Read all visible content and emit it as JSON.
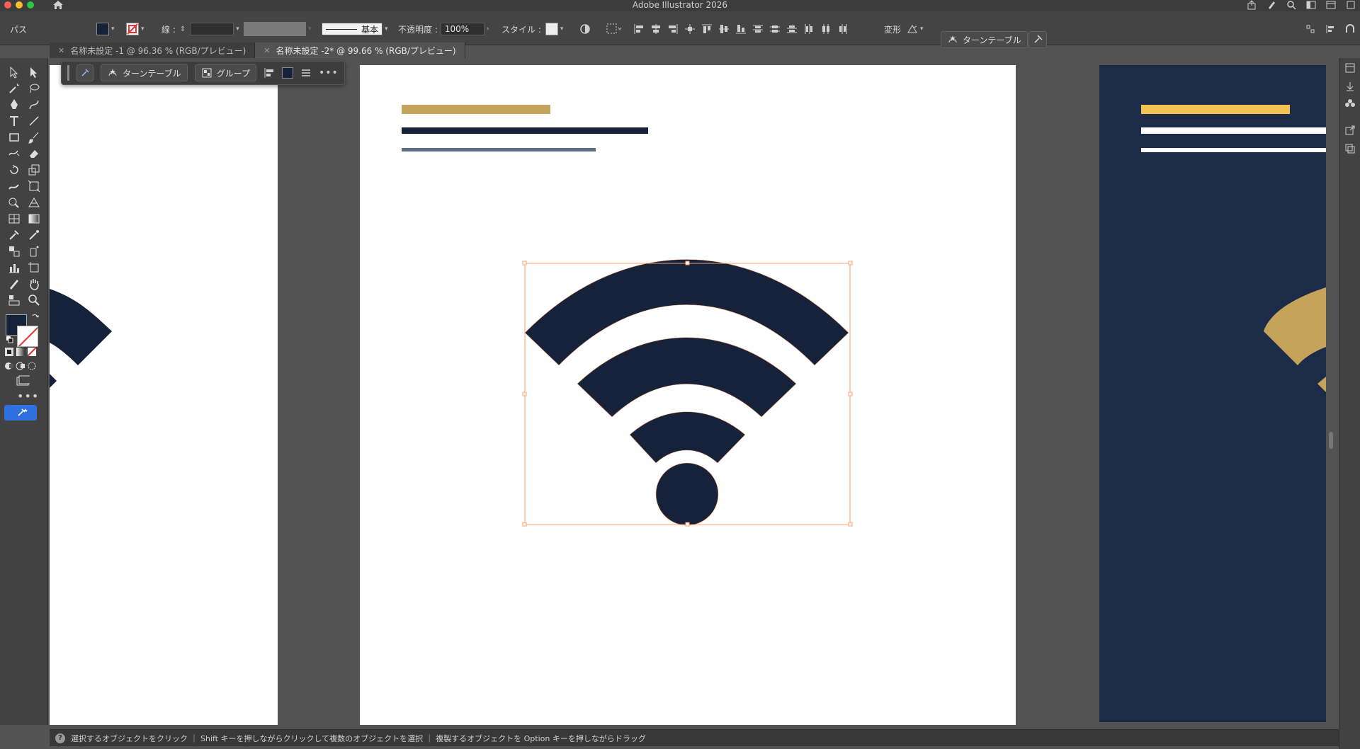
{
  "app": {
    "title": "Adobe Illustrator 2026"
  },
  "control_bar": {
    "selection_type": "パス",
    "stroke_label": "線 :",
    "stroke_style_label": "基本",
    "opacity_label": "不透明度 :",
    "opacity_value": "100%",
    "style_label": "スタイル :",
    "transform_label": "変形",
    "turntable_label": "ターンテーブル"
  },
  "tabs": [
    {
      "label": "名称未設定 -1 @ 96.36 % (RGB/プレビュー)",
      "active": false
    },
    {
      "label": "名称未設定 -2* @ 99.66 % (RGB/プレビュー)",
      "active": true
    }
  ],
  "context_bar": {
    "turntable_label": "ターンテーブル",
    "group_label": "グループ"
  },
  "status": {
    "help": "?",
    "message": "選択するオブジェクトをクリック ｜ Shift キーを押しながらクリックして複数のオブジェクトを選択 ｜ 複製するオブジェクトを Option キーを押しながらドラッグ"
  },
  "colors": {
    "navy": "#16213a",
    "gold": "#c4a45a",
    "slate": "#5d6c85",
    "dark_artboard": "#1c2b48",
    "yellow": "#f3c252",
    "selection": "#f7a070",
    "accent_blue": "#2f6fe0"
  },
  "icons": [
    "home-icon",
    "share-icon",
    "search-icon",
    "eraser-icon",
    "hand-icon",
    "zoom-icon",
    "ellipsis-icon",
    "turntable-icon"
  ]
}
